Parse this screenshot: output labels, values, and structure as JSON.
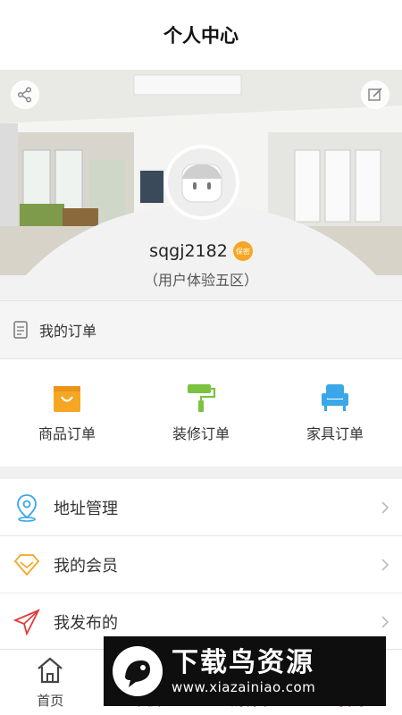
{
  "header": {
    "title": "个人中心"
  },
  "profile": {
    "username": "sqgj2182",
    "badge": "保密",
    "subtitle": "（用户体验五区）"
  },
  "orders": {
    "header_label": "我的订单",
    "types": [
      {
        "label": "商品订单",
        "icon": "shopping-bag-icon",
        "color": "#f5a623"
      },
      {
        "label": "装修订单",
        "icon": "paint-roller-icon",
        "color": "#7cc242"
      },
      {
        "label": "家具订单",
        "icon": "armchair-icon",
        "color": "#3aa7e8"
      }
    ]
  },
  "menu": [
    {
      "label": "地址管理",
      "icon": "location-pin-icon",
      "color": "#3aa7e8"
    },
    {
      "label": "我的会员",
      "icon": "diamond-icon",
      "color": "#f5a623"
    },
    {
      "label": "我发布的",
      "icon": "send-icon",
      "color": "#e4393c"
    }
  ],
  "tabbar": {
    "items": [
      {
        "label": "首页",
        "icon": "home-icon"
      },
      {
        "label": "图库",
        "icon": "gallery-icon"
      },
      {
        "label": "购物车",
        "icon": "cart-icon"
      },
      {
        "label": "我的",
        "icon": "user-icon"
      }
    ]
  },
  "watermark": {
    "title": "下载鸟资源",
    "url": "www.xiazainiao.com"
  }
}
